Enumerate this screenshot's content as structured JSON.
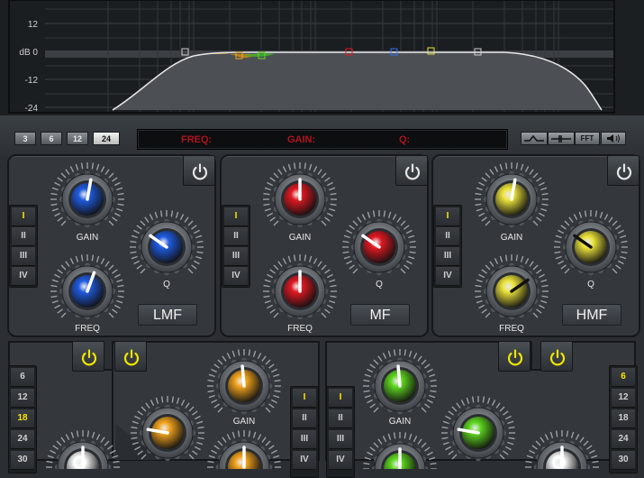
{
  "graph": {
    "db_labels": [
      "12",
      "dB 0",
      "-12",
      "-24"
    ]
  },
  "slope_buttons": [
    {
      "label": "3",
      "active": false
    },
    {
      "label": "6",
      "active": false
    },
    {
      "label": "12",
      "active": false
    },
    {
      "label": "24",
      "active": true
    }
  ],
  "readout": {
    "freq_label": "FREQ:",
    "gain_label": "GAIN:",
    "q_label": "Q:"
  },
  "view_buttons": [
    {
      "icon": "curve-icon"
    },
    {
      "icon": "flat-icon"
    },
    {
      "label": "FFT"
    },
    {
      "icon": "speaker-icon"
    }
  ],
  "bands": [
    {
      "name": "LMF",
      "color": "#1f5be0",
      "gain_label": "GAIN",
      "q_label": "Q",
      "freq_label": "FREQ",
      "selector": [
        "I",
        "II",
        "III",
        "IV"
      ],
      "selected": "I"
    },
    {
      "name": "MF",
      "color": "#e01822",
      "gain_label": "GAIN",
      "q_label": "Q",
      "freq_label": "FREQ",
      "selector": [
        "I",
        "II",
        "III",
        "IV"
      ],
      "selected": "I"
    },
    {
      "name": "HMF",
      "color": "#ece43a",
      "gain_label": "GAIN",
      "q_label": "Q",
      "freq_label": "FREQ",
      "selector": [
        "I",
        "II",
        "III",
        "IV"
      ],
      "selected": "I"
    }
  ],
  "bottom": {
    "left_slopes": [
      {
        "label": "6",
        "active": false
      },
      {
        "label": "12",
        "active": false
      },
      {
        "label": "18",
        "active": true
      },
      {
        "label": "24",
        "active": false
      },
      {
        "label": "30",
        "active": false
      }
    ],
    "right_slopes": [
      {
        "label": "6",
        "active": true
      },
      {
        "label": "12",
        "active": false
      },
      {
        "label": "18",
        "active": false
      },
      {
        "label": "24",
        "active": false
      },
      {
        "label": "30",
        "active": false
      }
    ],
    "orange_band": {
      "color": "#f0a21c",
      "gain_label": "GAIN",
      "selector": [
        "I",
        "II",
        "III",
        "IV"
      ],
      "selected": "I"
    },
    "green_band": {
      "color": "#5ed61f",
      "gain_label": "GAIN",
      "selector": [
        "I",
        "II",
        "III",
        "IV"
      ],
      "selected": "I"
    },
    "power_color": "#f0e400"
  }
}
